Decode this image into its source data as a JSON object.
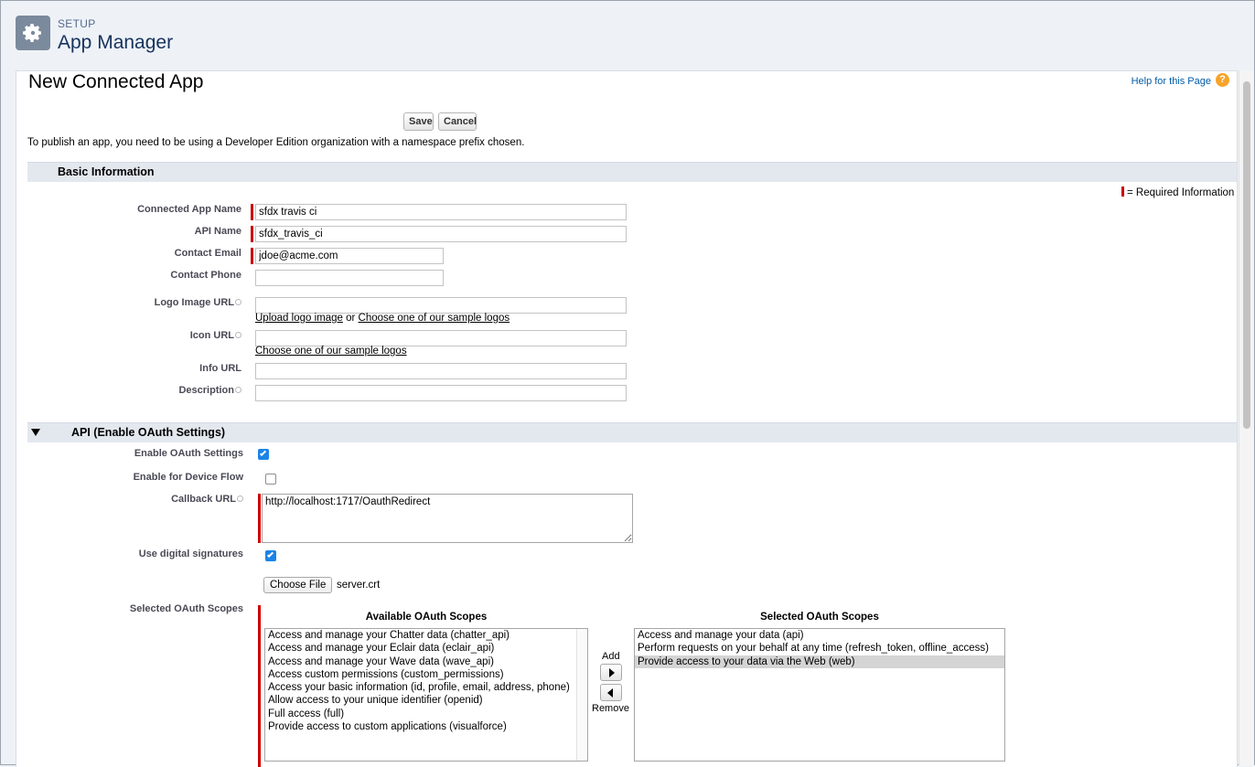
{
  "header": {
    "setup_label": "SETUP",
    "title": "App Manager",
    "icon": "gear-icon"
  },
  "page": {
    "title": "New Connected App",
    "help_link": "Help for this Page",
    "help_icon": "question-icon",
    "help_color": "#f7a32a"
  },
  "toolbar": {
    "save_label": "Save",
    "cancel_label": "Cancel"
  },
  "publish_note": "To publish an app, you need to be using a Developer Edition organization with a namespace prefix chosen.",
  "basic_info": {
    "section_title": "Basic Information",
    "required_legend": "= Required Information",
    "required_color": "#cc0000",
    "connected_app_name": {
      "label": "Connected App Name",
      "value": "sfdx travis ci"
    },
    "api_name": {
      "label": "API Name",
      "value": "sfdx_travis_ci"
    },
    "contact_email": {
      "label": "Contact Email",
      "value": "jdoe@acme.com"
    },
    "contact_phone": {
      "label": "Contact Phone",
      "value": ""
    },
    "logo_image_url": {
      "label": "Logo Image URL",
      "value": "",
      "upload_link": "Upload logo image",
      "or_text": " or ",
      "sample_link": "Choose one of our sample logos"
    },
    "icon_url": {
      "label": "Icon URL",
      "value": "",
      "sample_link": "Choose one of our sample logos"
    },
    "info_url": {
      "label": "Info URL",
      "value": ""
    },
    "description": {
      "label": "Description",
      "value": ""
    }
  },
  "api": {
    "section_title": "API (Enable OAuth Settings)",
    "enable_oauth": {
      "label": "Enable OAuth Settings",
      "checked": true
    },
    "device_flow": {
      "label": "Enable for Device Flow",
      "checked": false
    },
    "callback_url": {
      "label": "Callback URL",
      "value": "http://localhost:1717/OauthRedirect"
    },
    "digital_signatures": {
      "label": "Use digital signatures",
      "checked": true
    },
    "choose_file_label": "Choose File",
    "file_name": "server.crt",
    "scopes_label": "Selected OAuth Scopes",
    "available_heading": "Available OAuth Scopes",
    "selected_heading": "Selected OAuth Scopes",
    "add_label": "Add",
    "remove_label": "Remove",
    "available_scopes": [
      "Access and manage your Chatter data (chatter_api)",
      "Access and manage your Eclair data (eclair_api)",
      "Access and manage your Wave data (wave_api)",
      "Access custom permissions (custom_permissions)",
      "Access your basic information (id, profile, email, address, phone)",
      "Allow access to your unique identifier (openid)",
      "Full access (full)",
      "Provide access to custom applications (visualforce)"
    ],
    "selected_scopes": [
      "Access and manage your data (api)",
      "Perform requests on your behalf at any time (refresh_token, offline_access)",
      "Provide access to your data via the Web (web)"
    ],
    "highlighted_selected_index": 2,
    "checkbox_color": "#1b84e7"
  }
}
